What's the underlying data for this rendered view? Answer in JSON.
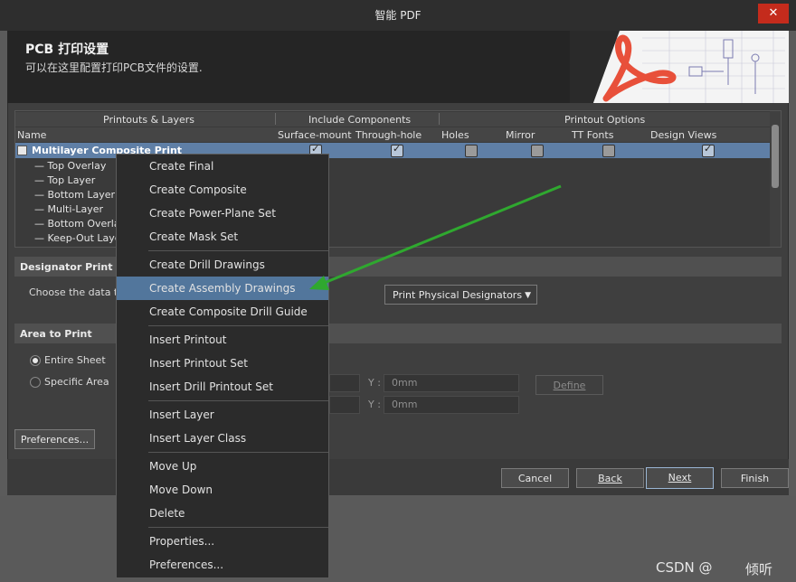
{
  "window": {
    "title": "智能 PDF",
    "close_glyph": "✕"
  },
  "header": {
    "title": "PCB 打印设置",
    "subtitle": "可以在这里配置打印PCB文件的设置."
  },
  "grid": {
    "group_headers": [
      "Printouts & Layers",
      "Include Components",
      "Printout Options"
    ],
    "columns": [
      "Name",
      "Surface-mount",
      "Through-hole",
      "Holes",
      "Mirror",
      "TT Fonts",
      "Design Views"
    ],
    "printout": {
      "name": "Multilayer Composite Print",
      "checks": [
        true,
        true,
        false,
        false,
        false,
        true
      ]
    },
    "layers": [
      "Top Overlay",
      "Top Layer",
      "Bottom Layer",
      "Multi-Layer",
      "Bottom Overlay",
      "Keep-Out Layer"
    ]
  },
  "designator": {
    "section_title": "Designator Print Setti",
    "label": "Choose the data to",
    "select_value": "Print Physical Designators"
  },
  "area": {
    "section_title": "Area to Print",
    "options": [
      "Entire Sheet",
      "Specific Area"
    ],
    "selected": 0,
    "y_label": "Y :",
    "y1": "0mm",
    "y2": "0mm",
    "define_label": "Define"
  },
  "preferences_button": "Preferences...",
  "footer": {
    "cancel": "Cancel",
    "back": "Back",
    "next": "Next",
    "finish": "Finish"
  },
  "context_menu": [
    {
      "label": "Create Final",
      "group": 0
    },
    {
      "label": "Create Composite",
      "group": 0
    },
    {
      "label": "Create Power-Plane Set",
      "group": 0
    },
    {
      "label": "Create Mask Set",
      "group": 0
    },
    {
      "label": "Create Drill Drawings",
      "group": 1
    },
    {
      "label": "Create Assembly Drawings",
      "group": 1,
      "highlighted": true
    },
    {
      "label": "Create Composite Drill Guide",
      "group": 1
    },
    {
      "label": "Insert Printout",
      "group": 2
    },
    {
      "label": "Insert Printout Set",
      "group": 2
    },
    {
      "label": "Insert Drill Printout Set",
      "group": 2
    },
    {
      "label": "Insert Layer",
      "group": 3
    },
    {
      "label": "Insert Layer Class",
      "group": 3
    },
    {
      "label": "Move Up",
      "group": 4
    },
    {
      "label": "Move Down",
      "group": 4
    },
    {
      "label": "Delete",
      "group": 4
    },
    {
      "label": "Properties...",
      "group": 5
    },
    {
      "label": "Preferences...",
      "group": 5
    }
  ],
  "watermark": {
    "text": "CSDN @",
    "author": "倾听"
  },
  "colors": {
    "accent": "#52769c",
    "arrow": "#2fa82f",
    "close": "#c42b1c"
  }
}
